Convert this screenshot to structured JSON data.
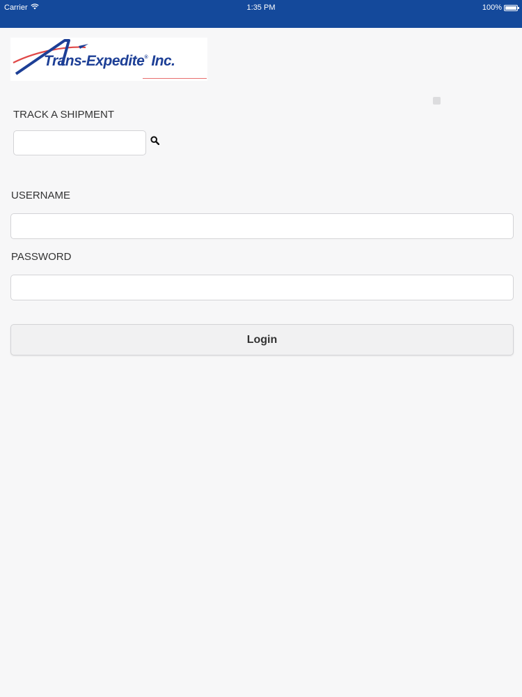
{
  "status_bar": {
    "carrier": "Carrier",
    "time": "1:35 PM",
    "battery": "100%",
    "battery_level": 1.0,
    "wifi_icon": "wifi-icon",
    "battery_icon": "battery-icon"
  },
  "brand": {
    "logo_text": "Trans-Expedite",
    "logo_mark": "®",
    "logo_suffix": " Inc.",
    "logo_color": "#1d3f96",
    "accent_color": "#e04848"
  },
  "track": {
    "label": "TRACK A SHIPMENT",
    "value": "",
    "placeholder": "",
    "search_icon": "search-icon"
  },
  "login": {
    "username_label": "USERNAME",
    "username_value": "",
    "username_placeholder": "",
    "password_label": "PASSWORD",
    "password_value": "",
    "password_placeholder": "",
    "button_label": "Login"
  },
  "colors": {
    "status_bar_bg": "#14499b",
    "page_bg": "#f7f7f8"
  }
}
